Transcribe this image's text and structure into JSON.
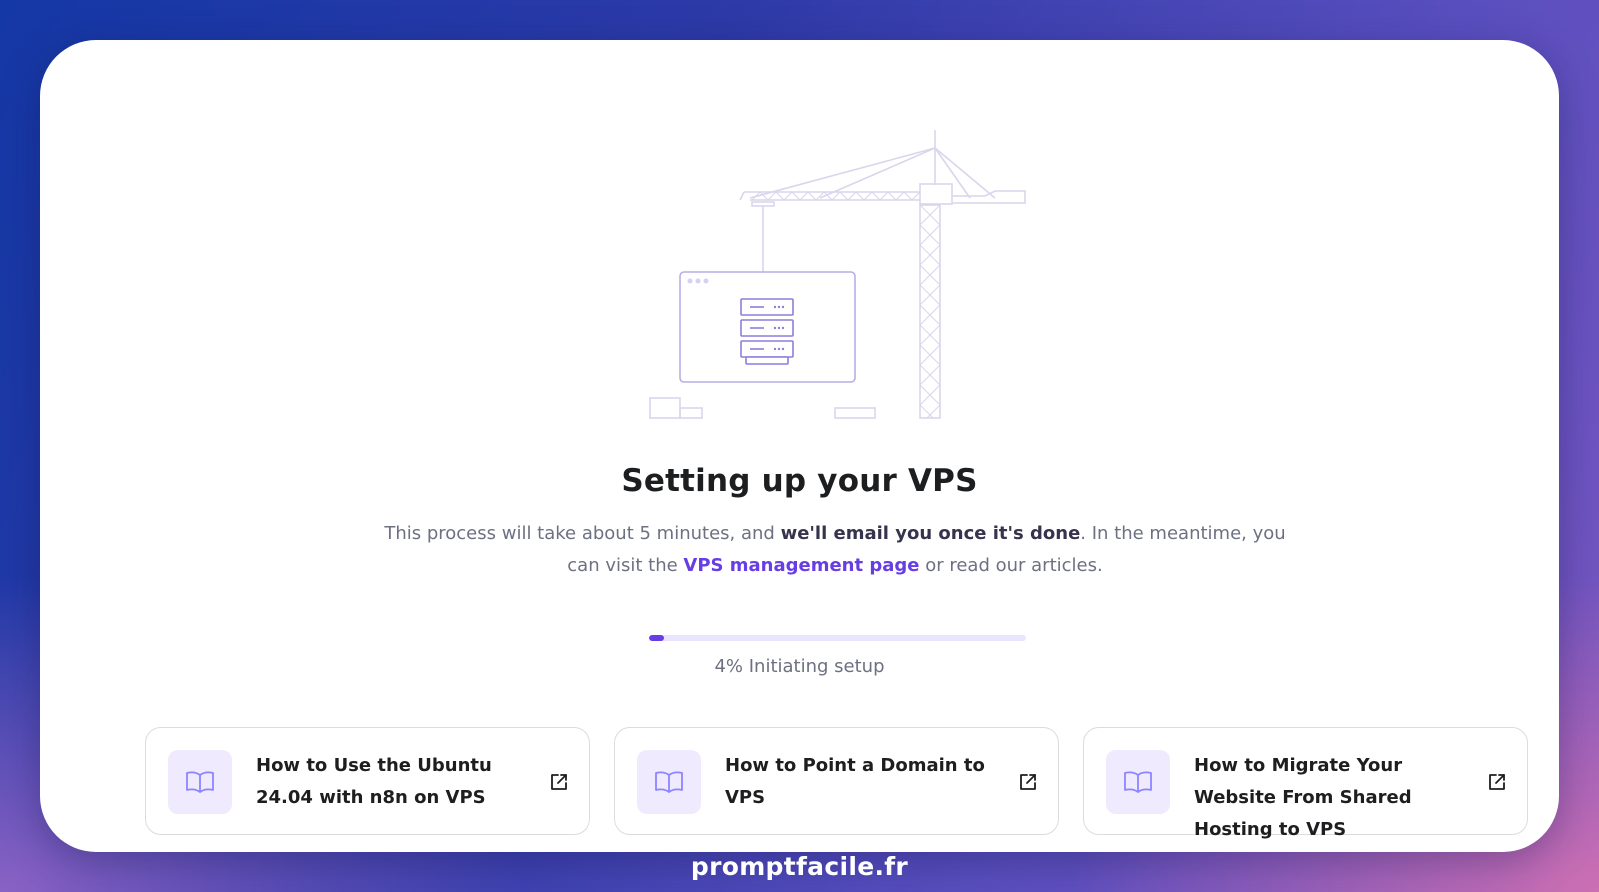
{
  "heading": "Setting up your VPS",
  "description": {
    "part1": "This process will take about 5 minutes, and ",
    "bold": "we'll email you once it's done",
    "part2": ". In the meantime, you can visit the ",
    "link": "VPS management page",
    "part3": " or read our articles."
  },
  "progress": {
    "percent": 4,
    "label": "4% Initiating setup"
  },
  "articles": [
    {
      "title": "How to Use the Ubuntu 24.04 with n8n on VPS",
      "icon": "book-icon",
      "action_icon": "external-link-icon"
    },
    {
      "title": "How to Point a Domain to VPS",
      "icon": "book-icon",
      "action_icon": "external-link-icon"
    },
    {
      "title": "How to Migrate Your Website From Shared Hosting to VPS",
      "icon": "book-icon",
      "action_icon": "external-link-icon"
    }
  ],
  "footer": {
    "brand": "promptfacile.fr"
  },
  "colors": {
    "accent": "#673de6",
    "progress_track": "#ebe4ff",
    "icon_bg": "#efeafd",
    "heading": "#1d1e20",
    "body_text": "#6d7081"
  }
}
